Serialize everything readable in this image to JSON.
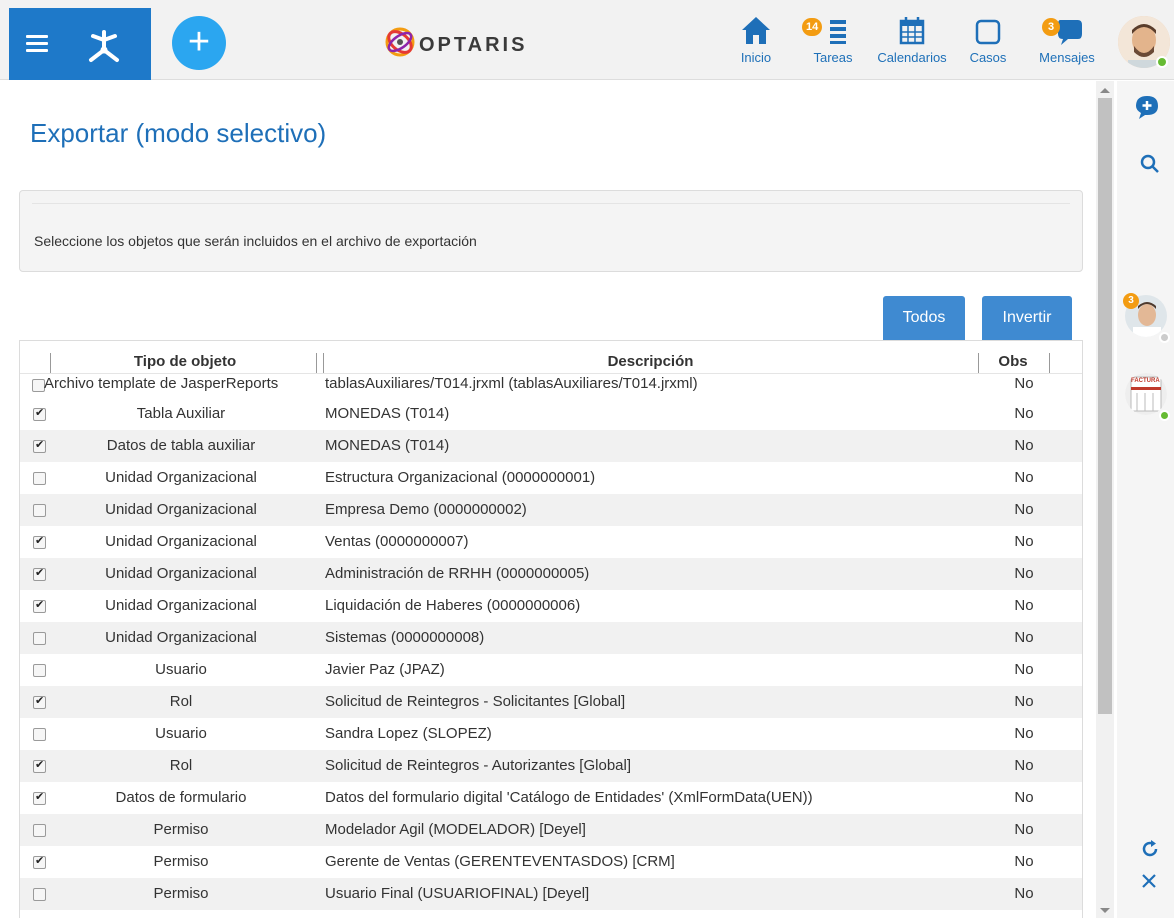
{
  "header": {
    "logo_text": "OPTARIS",
    "nav": [
      {
        "label": "Inicio",
        "icon": "home-icon"
      },
      {
        "label": "Tareas",
        "icon": "tasks-icon",
        "badge": "14"
      },
      {
        "label": "Calendarios",
        "icon": "calendar-icon"
      },
      {
        "label": "Casos",
        "icon": "cases-icon"
      },
      {
        "label": "Mensajes",
        "icon": "messages-icon",
        "badge": "3"
      }
    ],
    "colors": {
      "brand_blue": "#1e79c9",
      "add_button": "#2ba6f0",
      "badge": "#f39c12",
      "link": "#1e70b8"
    }
  },
  "page": {
    "title": "Exportar (modo selectivo)",
    "instructions": "Seleccione los objetos que serán incluidos en el archivo de exportación"
  },
  "actions": {
    "all_label": "Todos",
    "invert_label": "Invertir"
  },
  "table": {
    "headers": {
      "tipo": "Tipo de objeto",
      "descripcion": "Descripción",
      "obs": "Obs"
    },
    "rows": [
      {
        "checked": false,
        "tipo": "Archivo template de JasperReports",
        "descripcion": "tablasAuxiliares/T014.jrxml (tablasAuxiliares/T014.jrxml)",
        "obs": "No"
      },
      {
        "checked": true,
        "tipo": "Tabla Auxiliar",
        "descripcion": "MONEDAS (T014)",
        "obs": "No"
      },
      {
        "checked": true,
        "tipo": "Datos de tabla auxiliar",
        "descripcion": "MONEDAS (T014)",
        "obs": "No"
      },
      {
        "checked": false,
        "tipo": "Unidad Organizacional",
        "descripcion": "Estructura Organizacional (0000000001)",
        "obs": "No"
      },
      {
        "checked": false,
        "tipo": "Unidad Organizacional",
        "descripcion": "Empresa Demo (0000000002)",
        "obs": "No"
      },
      {
        "checked": true,
        "tipo": "Unidad Organizacional",
        "descripcion": "Ventas (0000000007)",
        "obs": "No"
      },
      {
        "checked": true,
        "tipo": "Unidad Organizacional",
        "descripcion": "Administración de RRHH (0000000005)",
        "obs": "No"
      },
      {
        "checked": true,
        "tipo": "Unidad Organizacional",
        "descripcion": "Liquidación de Haberes (0000000006)",
        "obs": "No"
      },
      {
        "checked": false,
        "tipo": "Unidad Organizacional",
        "descripcion": "Sistemas (0000000008)",
        "obs": "No"
      },
      {
        "checked": false,
        "tipo": "Usuario",
        "descripcion": "Javier Paz (JPAZ)",
        "obs": "No"
      },
      {
        "checked": true,
        "tipo": "Rol",
        "descripcion": "Solicitud de Reintegros - Solicitantes [Global]",
        "obs": "No"
      },
      {
        "checked": false,
        "tipo": "Usuario",
        "descripcion": "Sandra Lopez (SLOPEZ)",
        "obs": "No"
      },
      {
        "checked": true,
        "tipo": "Rol",
        "descripcion": "Solicitud de Reintegros - Autorizantes [Global]",
        "obs": "No"
      },
      {
        "checked": true,
        "tipo": "Datos de formulario",
        "descripcion": "Datos del formulario digital 'Catálogo de Entidades' (XmlFormData(UEN))",
        "obs": "No"
      },
      {
        "checked": false,
        "tipo": "Permiso",
        "descripcion": "Modelador Agil (MODELADOR) [Deyel]",
        "obs": "No"
      },
      {
        "checked": true,
        "tipo": "Permiso",
        "descripcion": "Gerente de Ventas (GERENTEVENTASDOS) [CRM]",
        "obs": "No"
      },
      {
        "checked": false,
        "tipo": "Permiso",
        "descripcion": "Usuario Final (USUARIOFINAL) [Deyel]",
        "obs": "No"
      }
    ]
  },
  "sidebar": {
    "contact_badge": "3",
    "form_thumbnail_text": "FACTURA",
    "icons": [
      "new-message-icon",
      "search-icon",
      "refresh-icon",
      "close-icon"
    ]
  }
}
